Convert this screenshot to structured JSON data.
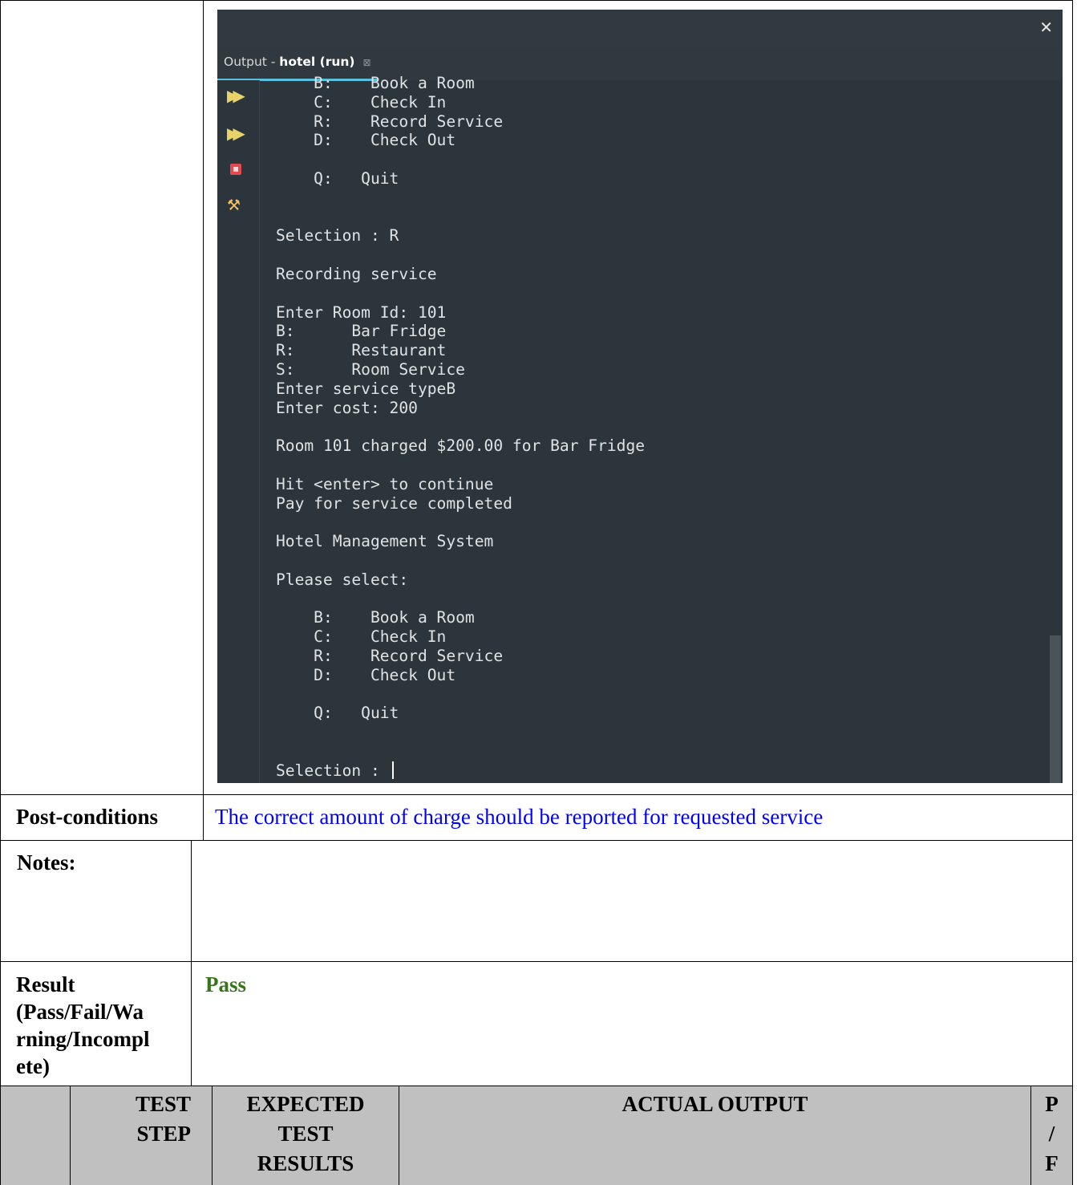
{
  "ide": {
    "tab_prefix": "Output - ",
    "tab_name": "hotel (run)",
    "tab_close": "⊠",
    "close_glyph": "✕",
    "console_lines": [
      "    B:    Book a Room",
      "    C:    Check In",
      "    R:    Record Service",
      "    D:    Check Out",
      "",
      "    Q:   Quit",
      "",
      "",
      "Selection : R",
      "",
      "Recording service",
      "",
      "Enter Room Id: 101",
      "B:      Bar Fridge",
      "R:      Restaurant",
      "S:      Room Service",
      "Enter service typeB",
      "Enter cost: 200",
      "",
      "Room 101 charged $200.00 for Bar Fridge",
      "",
      "Hit <enter> to continue",
      "Pay for service completed",
      "",
      "Hotel Management System",
      "",
      "Please select:",
      "",
      "    B:    Book a Room",
      "    C:    Check In",
      "    R:    Record Service",
      "    D:    Check Out",
      "",
      "    Q:   Quit",
      "",
      "",
      "Selection : "
    ],
    "icons": [
      "rerun-icon",
      "rerun-modified-icon",
      "stop-icon",
      "tools-icon"
    ],
    "colors": {
      "background": "#2b353b",
      "text": "#dfe3e5",
      "tab_underline": "#5bc0de"
    }
  },
  "table": {
    "postconditions_label": "Post-conditions",
    "postconditions_text": "The correct amount of charge should be reported for requested service",
    "notes_label": "Notes:",
    "result_label_lines": [
      "Result",
      "(Pass/Fail/Wa",
      "rning/Incompl",
      "ete)"
    ],
    "result_value": "Pass",
    "header": {
      "test_step": [
        "TEST",
        "STEP"
      ],
      "expected": [
        "EXPECTED",
        "TEST",
        "RESULTS"
      ],
      "actual": "ACTUAL OUTPUT",
      "pf": [
        "P",
        "/",
        "F"
      ]
    },
    "colors": {
      "blue_text": "#0000ff",
      "pass_green": "#38761d",
      "header_bg": "#c0c0c0"
    }
  }
}
